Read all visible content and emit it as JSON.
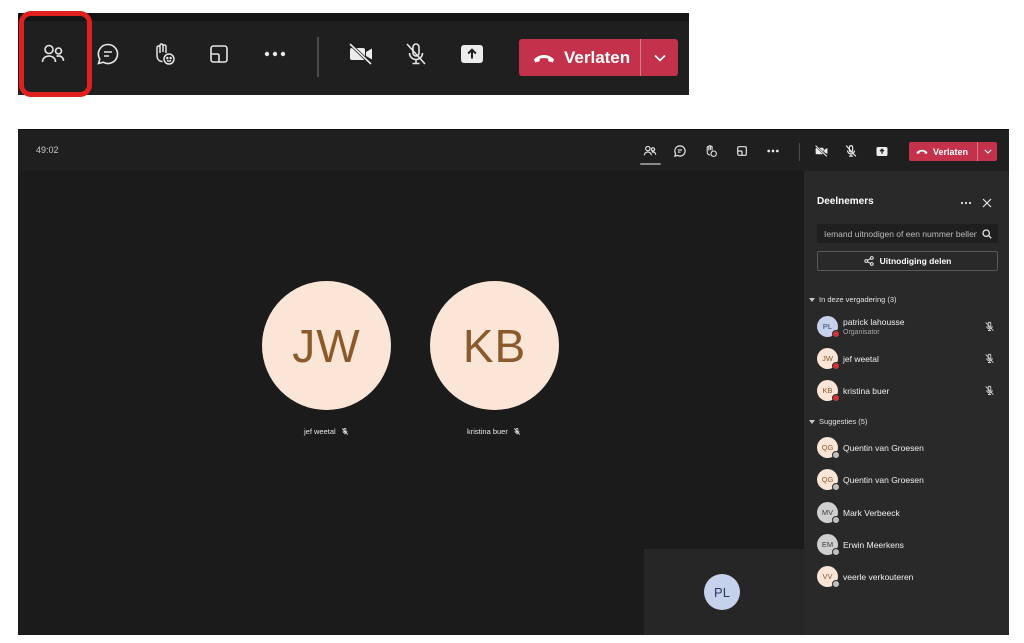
{
  "toolbar": {
    "items": [
      {
        "icon": "people-icon",
        "label": "Deelnemers"
      },
      {
        "icon": "chat-icon",
        "label": "Chat"
      },
      {
        "icon": "raise-hand-icon",
        "label": "Reacties"
      },
      {
        "icon": "rooms-icon",
        "label": "Ruimten"
      },
      {
        "icon": "more-icon",
        "label": "Meer"
      },
      {
        "icon": "camera-off-icon",
        "label": "Camera"
      },
      {
        "icon": "mic-off-icon",
        "label": "Microfoon"
      },
      {
        "icon": "share-icon",
        "label": "Delen"
      }
    ],
    "leave_label": "Verlaten",
    "highlight_color": "#e0201e",
    "leave_color": "#c4314b"
  },
  "meeting": {
    "timer": "49:02",
    "stage": {
      "tiles": [
        {
          "initials": "JW",
          "name": "jef weetal"
        },
        {
          "initials": "KB",
          "name": "kristina buer"
        }
      ],
      "self_initials": "PL"
    }
  },
  "panel": {
    "title": "Deelnemers",
    "search_placeholder": "Iemand uitnodigen of een nummer bellen",
    "share_label": "Uitnodiging delen",
    "in_meeting": {
      "header": "In deze vergadering (3)",
      "people": [
        {
          "initials": "PL",
          "name": "patrick lahousse",
          "role": "Organisator",
          "color": "blue"
        },
        {
          "initials": "JW",
          "name": "jef weetal",
          "role": "",
          "color": "peach"
        },
        {
          "initials": "KB",
          "name": "kristina buer",
          "role": "",
          "color": "peach"
        }
      ]
    },
    "suggestions": {
      "header": "Suggesties (5)",
      "people": [
        {
          "initials": "QG",
          "name": "Quentin van Groesen",
          "color": "peach"
        },
        {
          "initials": "QG",
          "name": "Quentin van Groesen",
          "color": "peach"
        },
        {
          "initials": "MV",
          "name": "Mark Verbeeck",
          "color": "grey"
        },
        {
          "initials": "EM",
          "name": "Erwin Meerkens",
          "color": "grey"
        },
        {
          "initials": "VV",
          "name": "veerle verkouteren",
          "color": "peach"
        }
      ]
    }
  }
}
